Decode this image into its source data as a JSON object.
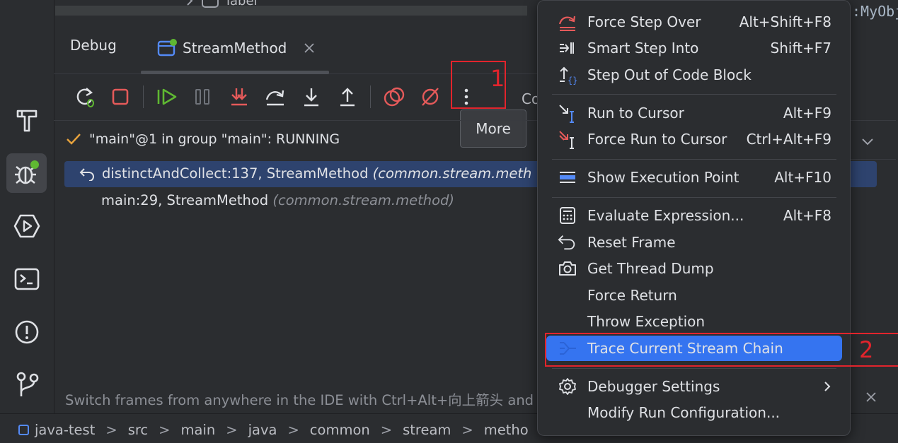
{
  "top_fragment": {
    "tree_label": "label",
    "code_fragment": ":MyObj"
  },
  "left_strip": {
    "items": [
      {
        "name": "build-icon"
      },
      {
        "name": "debug-icon"
      },
      {
        "name": "services-icon"
      },
      {
        "name": "terminal-icon"
      },
      {
        "name": "problems-icon"
      },
      {
        "name": "git-icon"
      }
    ]
  },
  "debug": {
    "title": "Debug",
    "tab_label": "StreamMethod",
    "more_tooltip": "More",
    "toolbar_cut_text": "Co",
    "annotation_1": "1",
    "annotation_2": "2"
  },
  "thread": {
    "text": "\"main\"@1 in group \"main\": RUNNING"
  },
  "frames": [
    {
      "method": "distinctAndCollect:137, StreamMethod",
      "package": "(common.stream.meth"
    },
    {
      "method": "main:29, StreamMethod",
      "package": "(common.stream.method)"
    }
  ],
  "hint": {
    "text": "Switch frames from anywhere in the IDE with Ctrl+Alt+向上箭头 and"
  },
  "breadcrumb": {
    "items": [
      "java-test",
      "src",
      "main",
      "java",
      "common",
      "stream",
      "metho"
    ]
  },
  "menu": {
    "items": [
      {
        "label": "Force Step Over",
        "shortcut": "Alt+Shift+F8",
        "icon": "force-step-over-icon"
      },
      {
        "label": "Smart Step Into",
        "shortcut": "Shift+F7",
        "icon": "smart-step-into-icon"
      },
      {
        "label": "Step Out of Code Block",
        "shortcut": "",
        "icon": "step-out-block-icon"
      },
      {
        "label": "Run to Cursor",
        "shortcut": "Alt+F9",
        "icon": "run-to-cursor-icon"
      },
      {
        "label": "Force Run to Cursor",
        "shortcut": "Ctrl+Alt+F9",
        "icon": "force-run-to-cursor-icon"
      },
      {
        "label": "Show Execution Point",
        "shortcut": "Alt+F10",
        "icon": "show-execution-point-icon"
      },
      {
        "label": "Evaluate Expression...",
        "shortcut": "Alt+F8",
        "icon": "calculator-icon"
      },
      {
        "label": "Reset Frame",
        "shortcut": "",
        "icon": "reset-frame-icon"
      },
      {
        "label": "Get Thread Dump",
        "shortcut": "",
        "icon": "camera-icon"
      },
      {
        "label": "Force Return",
        "shortcut": "",
        "icon": ""
      },
      {
        "label": "Throw Exception",
        "shortcut": "",
        "icon": ""
      },
      {
        "label": "Trace Current Stream Chain",
        "shortcut": "",
        "icon": "trace-stream-icon",
        "selected": true
      },
      {
        "label": "Debugger Settings",
        "shortcut": "",
        "icon": "gear-icon",
        "submenu": true
      },
      {
        "label": "Modify Run Configuration...",
        "shortcut": "",
        "icon": ""
      }
    ]
  },
  "colors": {
    "background": "#2b2d30",
    "selected_frame": "#2e436e",
    "menu_selected": "#3574f0",
    "annotation_red": "#e2242c",
    "accent_green": "#5fb832"
  }
}
